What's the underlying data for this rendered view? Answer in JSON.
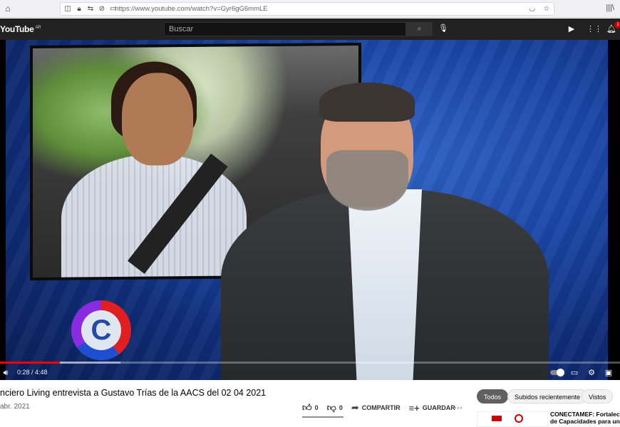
{
  "browser": {
    "url": "https://www.youtube.com/watch?v=Gyr6gG6mmLE"
  },
  "header": {
    "logo": "YouTube",
    "region": "AR",
    "search_placeholder": "Buscar",
    "notification_count": "1"
  },
  "player": {
    "time_current": "0:28",
    "time_total": "4:48",
    "progress_played": 0.097,
    "channel_logo_letter": "C"
  },
  "video": {
    "title": "nciero Living entrevista a Gustavo Trías de la AACS del 02 04 2021",
    "date": "abr. 2021",
    "likes": "0",
    "dislikes": "0",
    "share_label": "COMPARTIR",
    "save_label": "GUARDAR"
  },
  "chips": [
    "Todos",
    "Subidos recientemente",
    "Vistos"
  ],
  "recommendation": {
    "title_line1": "CONECTAMEF: Fortalecim",
    "title_line2": "de Capacidades para un G"
  },
  "colors": {
    "header_bg": "#212121",
    "progress": "#ff0000",
    "chip_active": "#606060"
  }
}
